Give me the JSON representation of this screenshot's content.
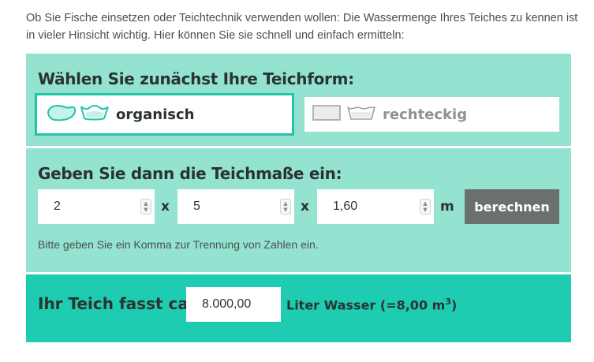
{
  "intro": {
    "text": "Ob Sie Fische einsetzen oder Teichtechnik verwenden wollen: Die Wassermenge Ihres Teiches zu kennen ist in vieler Hinsicht wichtig. Hier können Sie sie schnell und einfach ermitteln:"
  },
  "shape_section": {
    "heading": "Wählen Sie zunächst Ihre Teichform:",
    "options": [
      {
        "label": "organisch",
        "icons": [
          "organic-pond-shape-icon",
          "organic-basin-icon"
        ],
        "selected": true
      },
      {
        "label": "rechteckig",
        "icons": [
          "rectangle-pond-shape-icon",
          "rectangle-basin-icon"
        ],
        "selected": false
      }
    ],
    "accent_color": "#22c4a8"
  },
  "dimensions_section": {
    "heading": "Geben Sie dann die Teichmaße ein:",
    "fields": [
      {
        "value": "2"
      },
      {
        "value": "5"
      },
      {
        "value": "1,60"
      }
    ],
    "separator": "x",
    "unit": "m",
    "calculate_label": "berechnen",
    "hint": "Bitte geben Sie ein Komma zur Trennung von Zahlen ein."
  },
  "result_section": {
    "label": "Ihr Teich fasst ca.",
    "value": "8.000,00",
    "suffix": "Liter Wasser (=8,00 m",
    "suffix_exponent": "3",
    "suffix_close": ")"
  },
  "colors": {
    "panel": "#93e3d0",
    "result_panel": "#1ecdb1",
    "button": "#6b6f6e"
  }
}
